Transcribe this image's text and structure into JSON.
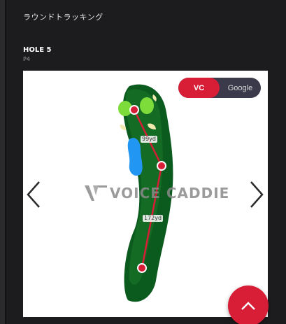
{
  "section_title": "ラウンドトラッキング",
  "hole": {
    "title": "HOLE 5",
    "par": "P4"
  },
  "map": {
    "toggle": {
      "options": [
        "VC",
        "Google"
      ],
      "selected": "VC"
    },
    "watermark": "VOICE CADDIE",
    "distances": [
      "99yd",
      "172yd"
    ]
  },
  "colors": {
    "accent": "#d81d36",
    "fairway": "#0b5a1e",
    "water": "#2196f3",
    "background": "#1c1c1e"
  },
  "icons": {
    "prev": "chevron-left-icon",
    "next": "chevron-right-icon",
    "fab": "chevron-up-icon"
  }
}
